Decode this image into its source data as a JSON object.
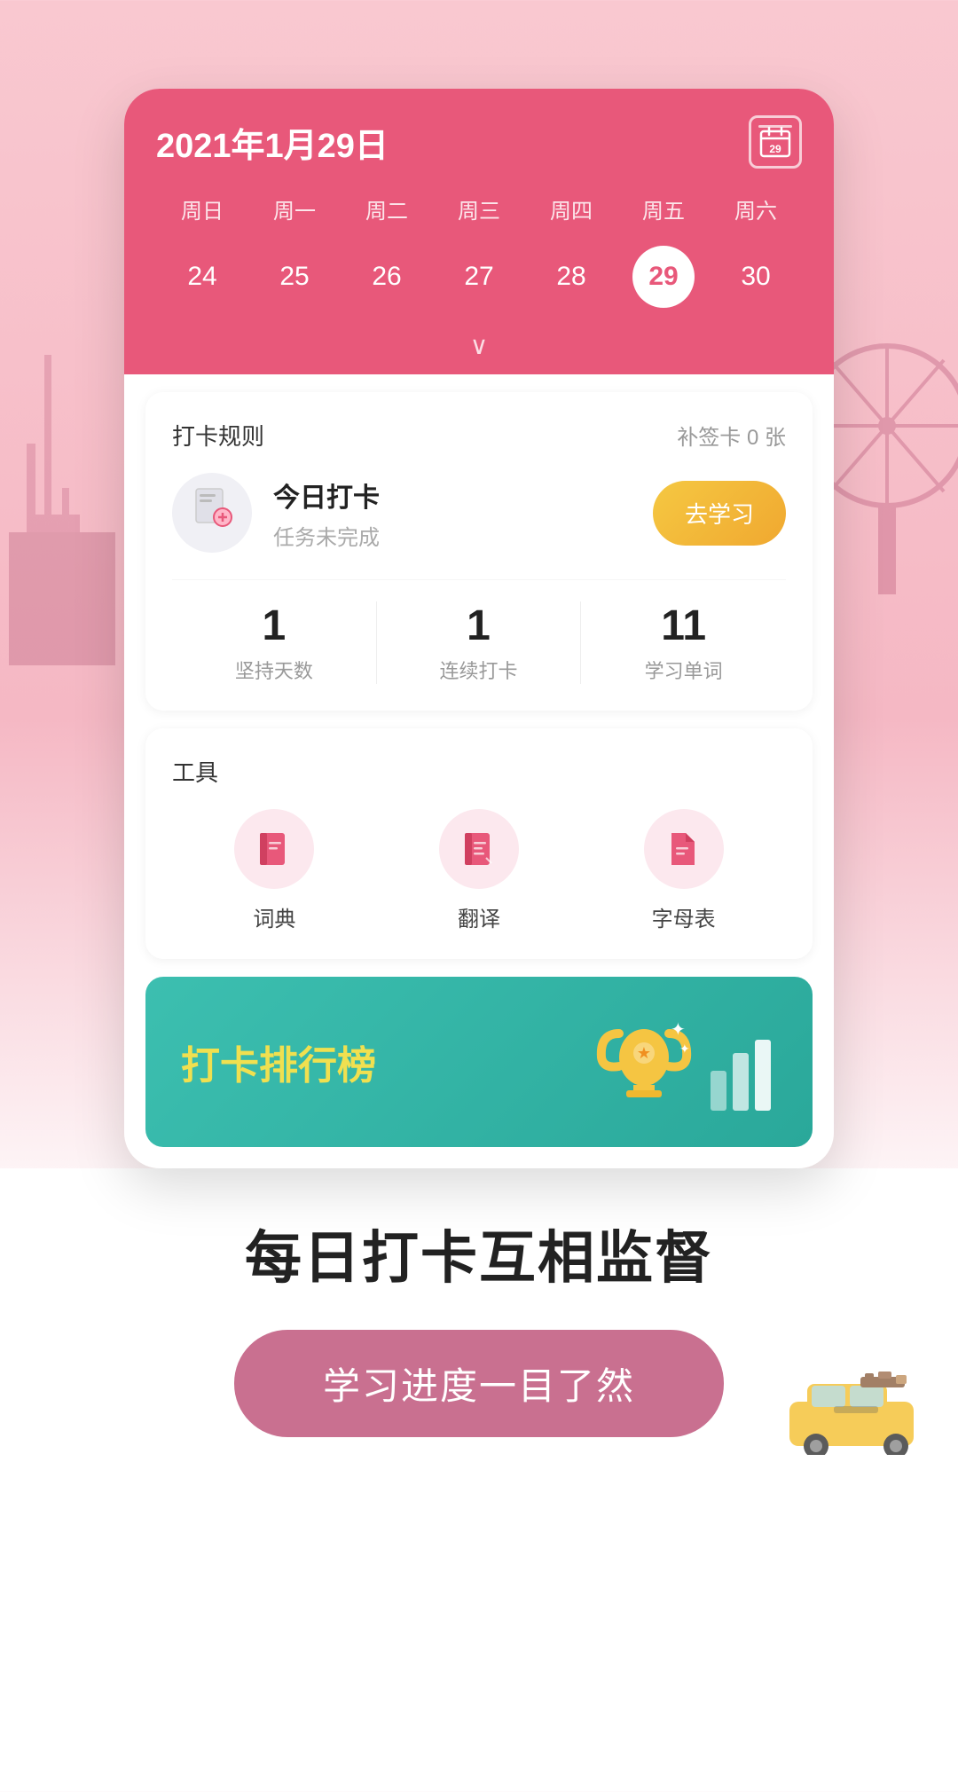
{
  "app": {
    "background_color": "#f9c8d0"
  },
  "calendar": {
    "title": "2021年1月29日",
    "icon_number": "29",
    "weekdays": [
      "周日",
      "周一",
      "周二",
      "周三",
      "周四",
      "周五",
      "周六"
    ],
    "dates": [
      {
        "day": "24",
        "active": false
      },
      {
        "day": "25",
        "active": false
      },
      {
        "day": "26",
        "active": false
      },
      {
        "day": "27",
        "active": false
      },
      {
        "day": "28",
        "active": false
      },
      {
        "day": "29",
        "active": true
      },
      {
        "day": "30",
        "active": false
      }
    ]
  },
  "checkin": {
    "title": "打卡规则",
    "supplement_label": "补签卡 0 张",
    "today_label": "今日打卡",
    "today_subtitle": "任务未完成",
    "go_study_label": "去学习",
    "stats": [
      {
        "number": "1",
        "label": "坚持天数"
      },
      {
        "number": "1",
        "label": "连续打卡"
      },
      {
        "number": "11",
        "label": "学习单词"
      }
    ]
  },
  "tools": {
    "title": "工具",
    "items": [
      {
        "label": "词典",
        "icon": "book"
      },
      {
        "label": "翻译",
        "icon": "translate"
      },
      {
        "label": "字母表",
        "icon": "alphabet"
      }
    ]
  },
  "ranking": {
    "text_prefix": "打卡",
    "text_highlight": "排行榜"
  },
  "bottom": {
    "slogan": "每日打卡互相监督",
    "cta_label": "学习进度一目了然"
  }
}
